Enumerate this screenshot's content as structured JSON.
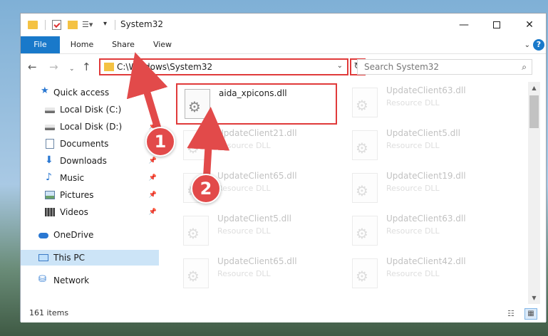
{
  "window": {
    "title": "System32",
    "controls": {
      "minimize": "—",
      "maximize": "",
      "close": "✕"
    }
  },
  "ribbon": {
    "tabs": [
      "File",
      "Home",
      "Share",
      "View"
    ],
    "help": "?",
    "expand": "⌄"
  },
  "nav": {
    "back": "←",
    "forward": "→",
    "recent": "⌄",
    "up": "↑",
    "address": "C:\\Windows\\System32",
    "address_drop": "⌄",
    "refresh": "↻",
    "search_placeholder": "Search System32",
    "search_icon": "⌕"
  },
  "sidebar": {
    "items": [
      {
        "label": "Quick access",
        "icon": "star-icon",
        "pinned": false
      },
      {
        "label": "Local Disk (C:)",
        "icon": "drive-icon",
        "pinned": false
      },
      {
        "label": "Local Disk (D:)",
        "icon": "drive-icon",
        "pinned": true
      },
      {
        "label": "Documents",
        "icon": "documents-icon",
        "pinned": true
      },
      {
        "label": "Downloads",
        "icon": "downloads-icon",
        "pinned": true
      },
      {
        "label": "Music",
        "icon": "music-icon",
        "pinned": true
      },
      {
        "label": "Pictures",
        "icon": "pictures-icon",
        "pinned": true
      },
      {
        "label": "Videos",
        "icon": "videos-icon",
        "pinned": true
      },
      {
        "label": "OneDrive",
        "icon": "onedrive-icon",
        "pinned": false
      },
      {
        "label": "This PC",
        "icon": "this-pc-icon",
        "pinned": false,
        "selected": true
      },
      {
        "label": "Network",
        "icon": "network-icon",
        "pinned": false
      }
    ],
    "pin_glyph": "📌"
  },
  "files": [
    {
      "name": "aida_xpicons.dll",
      "type": "",
      "highlighted": true
    },
    {
      "name": "UpdateClient63.dll",
      "type": "Resource DLL"
    },
    {
      "name": "UpdateClient21.dll",
      "type": "Resource DLL"
    },
    {
      "name": "UpdateClient5.dll",
      "type": "Resource DLL"
    },
    {
      "name": "UpdateClient65.dll",
      "type": "Resource DLL"
    },
    {
      "name": "UpdateClient19.dll",
      "type": "Resource DLL"
    },
    {
      "name": "UpdateClient5.dll",
      "type": "Resource DLL"
    },
    {
      "name": "UpdateClient63.dll",
      "type": "Resource DLL"
    },
    {
      "name": "UpdateClient65.dll",
      "type": "Resource DLL"
    },
    {
      "name": "UpdateClient42.dll",
      "type": "Resource DLL"
    }
  ],
  "scrollbar": {
    "up": "▲",
    "down": "▼"
  },
  "status": {
    "item_count": "161 items",
    "details_glyph": "☷",
    "tiles_glyph": "▦"
  },
  "callouts": [
    "1",
    "2"
  ],
  "colors": {
    "accent": "#1979ca",
    "highlight": "#e03a3a",
    "callout": "#e24a4a",
    "selection": "#cce4f7"
  }
}
